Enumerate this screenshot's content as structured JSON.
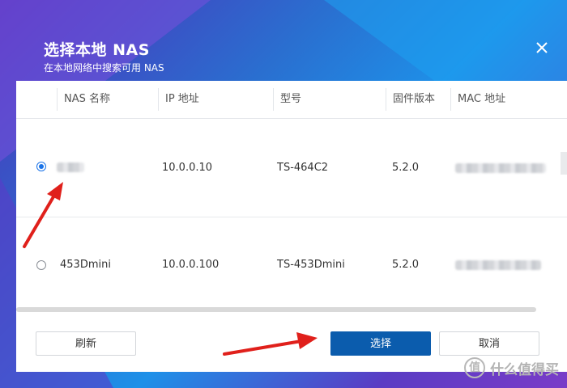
{
  "dialog": {
    "title": "选择本地 NAS",
    "subtitle": "在本地网络中搜索可用 NAS",
    "close_icon": "close-icon"
  },
  "table": {
    "columns": [
      "NAS 名称",
      "IP 地址",
      "型号",
      "固件版本",
      "MAC 地址"
    ],
    "rows": [
      {
        "selected": true,
        "name": "",
        "ip": "10.0.0.10",
        "model": "TS-464C2",
        "firmware": "5.2.0",
        "mac": ""
      },
      {
        "selected": false,
        "name": "453Dmini",
        "ip": "10.0.0.100",
        "model": "TS-453Dmini",
        "firmware": "5.2.0",
        "mac": ""
      }
    ]
  },
  "buttons": {
    "refresh": "刷新",
    "select": "选择",
    "cancel": "取消"
  },
  "watermark": {
    "symbol": "值",
    "text": "什么值得买"
  },
  "colors": {
    "primary": "#0b5cad",
    "arrow": "#e0201b",
    "radio_checked": "#1a73e8"
  }
}
